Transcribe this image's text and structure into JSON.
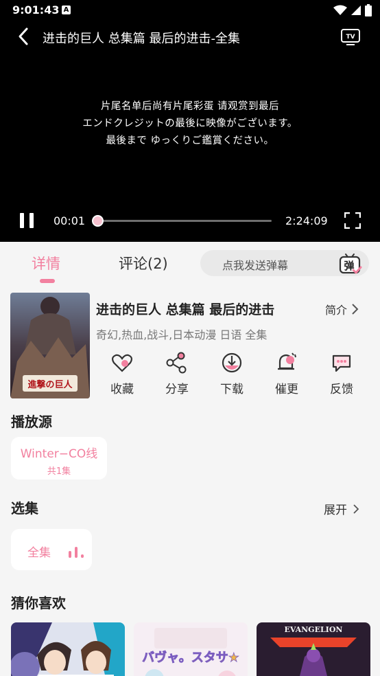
{
  "status": {
    "time": "9:01:43",
    "notif_letter": "A"
  },
  "player": {
    "title": "进击的巨人 总集篇 最后的进击-全集",
    "subtitle_lines": [
      "片尾名单后尚有片尾彩蛋 请观赏到最后",
      "エンドクレジットの最後に映像がございます。",
      "最後まで ゆっくりご鑑賞ください。"
    ],
    "current_time": "00:01",
    "duration": "2:24:09",
    "progress_fraction": 0.0,
    "tv_icon_text": "TV"
  },
  "tabs": {
    "detail": "详情",
    "comments": "评论(2)",
    "danmaku_placeholder": "点我发送弹幕",
    "danmaku_icon_text": "弹"
  },
  "anime": {
    "name": "进击的巨人 总集篇 最后的进击",
    "intro_label": "简介",
    "tags": "奇幻,热血,战斗,日本动漫 日语 全集",
    "poster_logo": "進撃の巨人"
  },
  "actions": [
    {
      "label": "收藏",
      "icon": "heart-icon"
    },
    {
      "label": "分享",
      "icon": "share-icon"
    },
    {
      "label": "下载",
      "icon": "download-icon"
    },
    {
      "label": "催更",
      "icon": "bell-icon"
    },
    {
      "label": "反馈",
      "icon": "feedback-icon"
    }
  ],
  "source": {
    "section_title": "播放源",
    "name": "Winter−CO线",
    "count": "共1集"
  },
  "episodes": {
    "section_title": "选集",
    "expand_label": "展开",
    "items": [
      "全集"
    ]
  },
  "recommend": {
    "section_title": "猜你喜欢",
    "items": [
      {
        "poster": "anime-boys-poster"
      },
      {
        "poster": "pastel-logo-poster",
        "logo": "バヴャ。スタサ★"
      },
      {
        "poster": "evangelion-poster",
        "logo": "EVANGELION"
      }
    ]
  },
  "colors": {
    "accent": "#f2809f",
    "player_bg": "#000000",
    "page_bg": "#f5f5f5"
  }
}
